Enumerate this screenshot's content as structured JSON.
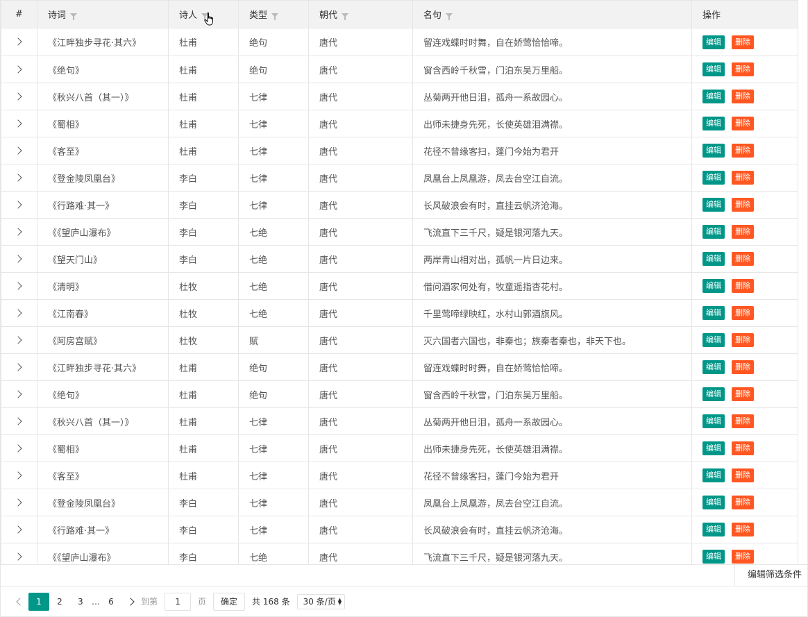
{
  "table": {
    "headers": {
      "index": "#",
      "title": "诗词",
      "poet": "诗人",
      "type": "类型",
      "dynasty": "朝代",
      "line": "名句",
      "action": "操作"
    },
    "edit_label": "编辑",
    "delete_label": "删除",
    "rows": [
      {
        "title": "《江畔独步寻花·其六》",
        "poet": "杜甫",
        "type": "绝句",
        "dynasty": "唐代",
        "line": "留连戏蝶时时舞，自在娇莺恰恰啼。"
      },
      {
        "title": "《绝句》",
        "poet": "杜甫",
        "type": "绝句",
        "dynasty": "唐代",
        "line": "窗含西岭千秋雪，门泊东吴万里船。"
      },
      {
        "title": "《秋兴八首（其一）》",
        "poet": "杜甫",
        "type": "七律",
        "dynasty": "唐代",
        "line": "丛菊两开他日泪，孤舟一系故园心。"
      },
      {
        "title": "《蜀相》",
        "poet": "杜甫",
        "type": "七律",
        "dynasty": "唐代",
        "line": "出师未捷身先死，长使英雄泪满襟。"
      },
      {
        "title": "《客至》",
        "poet": "杜甫",
        "type": "七律",
        "dynasty": "唐代",
        "line": "花径不曾缘客扫，蓬门今始为君开"
      },
      {
        "title": "《登金陵凤凰台》",
        "poet": "李白",
        "type": "七律",
        "dynasty": "唐代",
        "line": "凤凰台上凤凰游，凤去台空江自流。"
      },
      {
        "title": "《行路难·其一》",
        "poet": "李白",
        "type": "七律",
        "dynasty": "唐代",
        "line": "长风破浪会有时，直挂云帆济沧海。"
      },
      {
        "title": "《《望庐山瀑布》",
        "poet": "李白",
        "type": "七绝",
        "dynasty": "唐代",
        "line": "飞流直下三千尺，疑是银河落九天。"
      },
      {
        "title": "《望天门山》",
        "poet": "李白",
        "type": "七绝",
        "dynasty": "唐代",
        "line": "两岸青山相对出，孤帆一片日边来。"
      },
      {
        "title": "《清明》",
        "poet": "杜牧",
        "type": "七绝",
        "dynasty": "唐代",
        "line": "借问酒家何处有，牧童遥指杏花村。"
      },
      {
        "title": "《江南春》",
        "poet": "杜牧",
        "type": "七绝",
        "dynasty": "唐代",
        "line": "千里莺啼绿映红，水村山郭酒旗风。"
      },
      {
        "title": "《阿房宫赋》",
        "poet": "杜牧",
        "type": "赋",
        "dynasty": "唐代",
        "line": "灭六国者六国也，非秦也；族秦者秦也，非天下也。"
      },
      {
        "title": "《江畔独步寻花·其六》",
        "poet": "杜甫",
        "type": "绝句",
        "dynasty": "唐代",
        "line": "留连戏蝶时时舞，自在娇莺恰恰啼。"
      },
      {
        "title": "《绝句》",
        "poet": "杜甫",
        "type": "绝句",
        "dynasty": "唐代",
        "line": "窗含西岭千秋雪，门泊东吴万里船。"
      },
      {
        "title": "《秋兴八首（其一）》",
        "poet": "杜甫",
        "type": "七律",
        "dynasty": "唐代",
        "line": "丛菊两开他日泪，孤舟一系故园心。"
      },
      {
        "title": "《蜀相》",
        "poet": "杜甫",
        "type": "七律",
        "dynasty": "唐代",
        "line": "出师未捷身先死，长使英雄泪满襟。"
      },
      {
        "title": "《客至》",
        "poet": "杜甫",
        "type": "七律",
        "dynasty": "唐代",
        "line": "花径不曾缘客扫，蓬门今始为君开"
      },
      {
        "title": "《登金陵凤凰台》",
        "poet": "李白",
        "type": "七律",
        "dynasty": "唐代",
        "line": "凤凰台上凤凰游，凤去台空江自流。"
      },
      {
        "title": "《行路难·其一》",
        "poet": "李白",
        "type": "七律",
        "dynasty": "唐代",
        "line": "长风破浪会有时，直挂云帆济沧海。"
      },
      {
        "title": "《《望庐山瀑布》",
        "poet": "李白",
        "type": "七绝",
        "dynasty": "唐代",
        "line": "飞流直下三千尺，疑是银河落九天。"
      }
    ]
  },
  "filter_bar": {
    "edit_filter_label": "编辑筛选条件"
  },
  "pagination": {
    "pages": [
      "1",
      "2",
      "3"
    ],
    "ellipsis": "…",
    "last_page": "6",
    "current_page": "1",
    "goto_label": "到第",
    "goto_value": "1",
    "page_unit": "页",
    "confirm_label": "确定",
    "total_text": "共 168 条",
    "page_size": "30 条/页"
  },
  "colors": {
    "accent": "#009688",
    "danger": "#ff5722",
    "header_bg": "#f2f2f2",
    "border": "#e6e6e6"
  }
}
